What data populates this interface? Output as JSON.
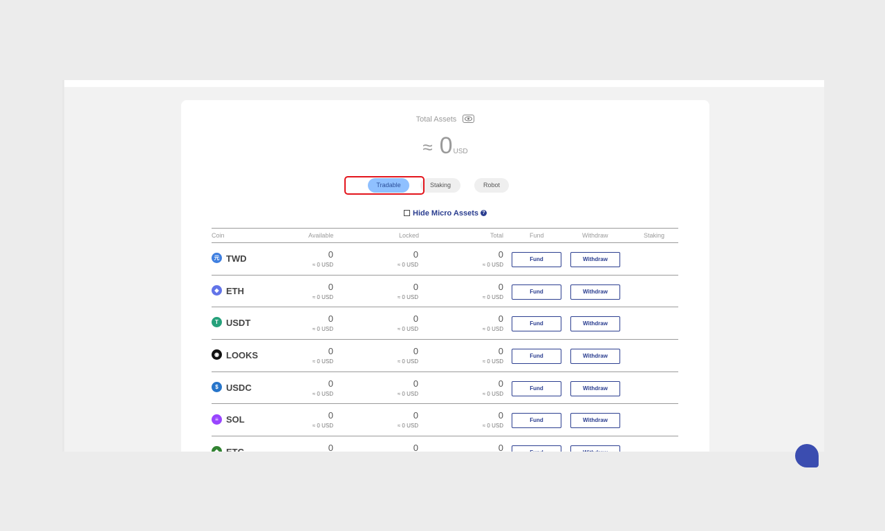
{
  "summary": {
    "total_label": "Total Assets",
    "approx_symbol": "≈",
    "total_value": "0",
    "total_unit": "USD"
  },
  "tabs": [
    {
      "label": "Tradable",
      "active": true
    },
    {
      "label": "Staking",
      "active": false
    },
    {
      "label": "Robot",
      "active": false
    }
  ],
  "filter": {
    "hide_micro_label": "Hide Micro Assets",
    "help_symbol": "?"
  },
  "table": {
    "headers": {
      "coin": "Coin",
      "available": "Available",
      "locked": "Locked",
      "total": "Total",
      "fund": "Fund",
      "withdraw": "Withdraw",
      "staking": "Staking"
    },
    "fund_label": "Fund",
    "withdraw_label": "Withdraw",
    "rows": [
      {
        "coin": "TWD",
        "icon": "twd-icon",
        "color": "#3f7fe0",
        "glyph": "元",
        "available": "0",
        "available_usd": "≈ 0 USD",
        "locked": "0",
        "locked_usd": "≈ 0 USD",
        "total": "0",
        "total_usd": "≈ 0 USD"
      },
      {
        "coin": "ETH",
        "icon": "eth-icon",
        "color": "#6274e8",
        "glyph": "◆",
        "available": "0",
        "available_usd": "≈ 0 USD",
        "locked": "0",
        "locked_usd": "≈ 0 USD",
        "total": "0",
        "total_usd": "≈ 0 USD"
      },
      {
        "coin": "USDT",
        "icon": "usdt-icon",
        "color": "#26a17b",
        "glyph": "T",
        "available": "0",
        "available_usd": "≈ 0 USD",
        "locked": "0",
        "locked_usd": "≈ 0 USD",
        "total": "0",
        "total_usd": "≈ 0 USD"
      },
      {
        "coin": "LOOKS",
        "icon": "looks-icon",
        "color": "#111111",
        "glyph": "◉",
        "available": "0",
        "available_usd": "≈ 0 USD",
        "locked": "0",
        "locked_usd": "≈ 0 USD",
        "total": "0",
        "total_usd": "≈ 0 USD"
      },
      {
        "coin": "USDC",
        "icon": "usdc-icon",
        "color": "#2775ca",
        "glyph": "$",
        "available": "0",
        "available_usd": "≈ 0 USD",
        "locked": "0",
        "locked_usd": "≈ 0 USD",
        "total": "0",
        "total_usd": "≈ 0 USD"
      },
      {
        "coin": "SOL",
        "icon": "sol-icon",
        "color": "#9945ff",
        "glyph": "≡",
        "available": "0",
        "available_usd": "≈ 0 USD",
        "locked": "0",
        "locked_usd": "≈ 0 USD",
        "total": "0",
        "total_usd": "≈ 0 USD"
      },
      {
        "coin": "ETC",
        "icon": "etc-icon",
        "color": "#328332",
        "glyph": "◆",
        "available": "0",
        "available_usd": "",
        "locked": "0",
        "locked_usd": "",
        "total": "0",
        "total_usd": ""
      }
    ]
  }
}
